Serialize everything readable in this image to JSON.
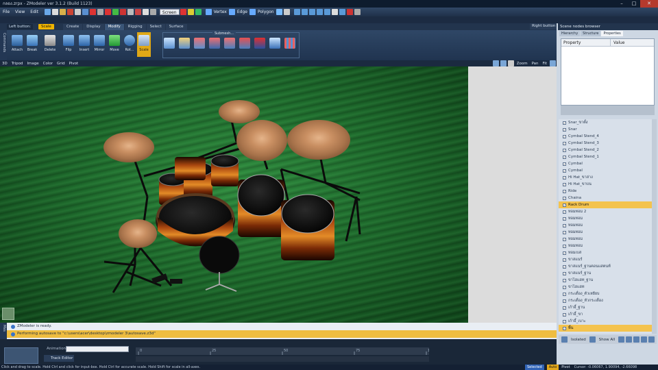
{
  "window": {
    "title": "กลอง.zrpx - ZModeler ver 3.1.2 (Build 1123)",
    "controls": [
      "–",
      "□",
      "✕"
    ]
  },
  "menubar": {
    "items": [
      "File",
      "View",
      "Edit"
    ]
  },
  "toolbar": {
    "coord_system": "Screen",
    "modes": [
      "Vertex",
      "Edge",
      "Polygon"
    ]
  },
  "ribbon": {
    "left_button": "Left button:",
    "active_tool": "Scale",
    "tabs": [
      "Create",
      "Display",
      "Modify",
      "Rigging",
      "Select",
      "Surface"
    ],
    "right_button": "Right button",
    "commands": [
      "Attach",
      "Break",
      "Delete",
      "Flip",
      "Insert",
      "Mirror",
      "Move",
      "Rot...",
      "Scale"
    ],
    "submesh_label": "Submesh...",
    "side_label": "Commands"
  },
  "viewport_bar": {
    "items": [
      "3D",
      "Tripod",
      "Image",
      "Color",
      "Grid",
      "Pivot"
    ],
    "right_items": [
      "Zoom",
      "Pan",
      "Fit"
    ]
  },
  "right_panel": {
    "title": "Scene nodes browser",
    "tabs": [
      "Hierarchy",
      "Structure",
      "Properties"
    ],
    "columns": [
      "Property",
      "Value"
    ],
    "nodes": [
      {
        "name": "Snar_ขาตั้ง",
        "selected": false
      },
      {
        "name": "Snar",
        "selected": false
      },
      {
        "name": "Cymbal Stend_4",
        "selected": false
      },
      {
        "name": "Cymbal Stend_3",
        "selected": false
      },
      {
        "name": "Cymbal Stend_2",
        "selected": false
      },
      {
        "name": "Cymbal Stend_1",
        "selected": false
      },
      {
        "name": "Cymbal",
        "selected": false
      },
      {
        "name": "Cymbal",
        "selected": false
      },
      {
        "name": "Hi Hat_ขาล่าง",
        "selected": false
      },
      {
        "name": "Hi Hat_ขาบน",
        "selected": false
      },
      {
        "name": "Ride",
        "selected": false
      },
      {
        "name": "Chaina",
        "selected": false
      },
      {
        "name": "Rack Drum",
        "selected": true
      },
      {
        "name": "ทอมทอม 2",
        "selected": false
      },
      {
        "name": "ทอมทอม",
        "selected": false
      },
      {
        "name": "ทอมทอม",
        "selected": false
      },
      {
        "name": "ทอมทอม",
        "selected": false
      },
      {
        "name": "ทอมทอม",
        "selected": false
      },
      {
        "name": "ทอมทอม",
        "selected": false
      },
      {
        "name": "ทอมเบส",
        "selected": false
      },
      {
        "name": "ขาสแนร์",
        "selected": false
      },
      {
        "name": "ขาสแนร์_ฐานคอนแสตนท์",
        "selected": false
      },
      {
        "name": "ขาสแนร์_ฐาน",
        "selected": false
      },
      {
        "name": "ขาไฮแฮท_ฐาน",
        "selected": false
      },
      {
        "name": "ขาไฮแฮท",
        "selected": false
      },
      {
        "name": "กระเดื่อง_ตัวเหยียบ",
        "selected": false
      },
      {
        "name": "กระเดื่อง_หัวกระเดื่อง",
        "selected": false
      },
      {
        "name": "เก้าอี้_ฐาน",
        "selected": false
      },
      {
        "name": "เก้าอี้_ขา",
        "selected": false
      },
      {
        "name": "เก้าอี้_เบาะ",
        "selected": false
      },
      {
        "name": "พื้น",
        "selected": true
      }
    ],
    "bottom": {
      "isolated": "Isolated",
      "show_all": "Show All"
    }
  },
  "log": {
    "lines": [
      {
        "text": "ZModeler is ready.",
        "highlight": false
      },
      {
        "text": "Performing autosave to \"c:\\users\\acer\\desktop\\zmodeler 3\\autosave.z3d\"",
        "highlight": true
      }
    ],
    "side_label": "Mes"
  },
  "animation": {
    "label": "Animation:",
    "track_editor": "Track Editor",
    "ticks": [
      "0",
      "25",
      "50",
      "75",
      "100"
    ]
  },
  "status": {
    "hint": "Click and drag to scale. Hold Ctrl and click for input-box. Hold Ctrl for accurate scale. Hold Shift for scale in all-axes.",
    "selected": "Selected",
    "auto": "Auto",
    "pivot": "Pivot",
    "cursor": "Cursor: -0.06067, 1.90094, -2.66098"
  }
}
